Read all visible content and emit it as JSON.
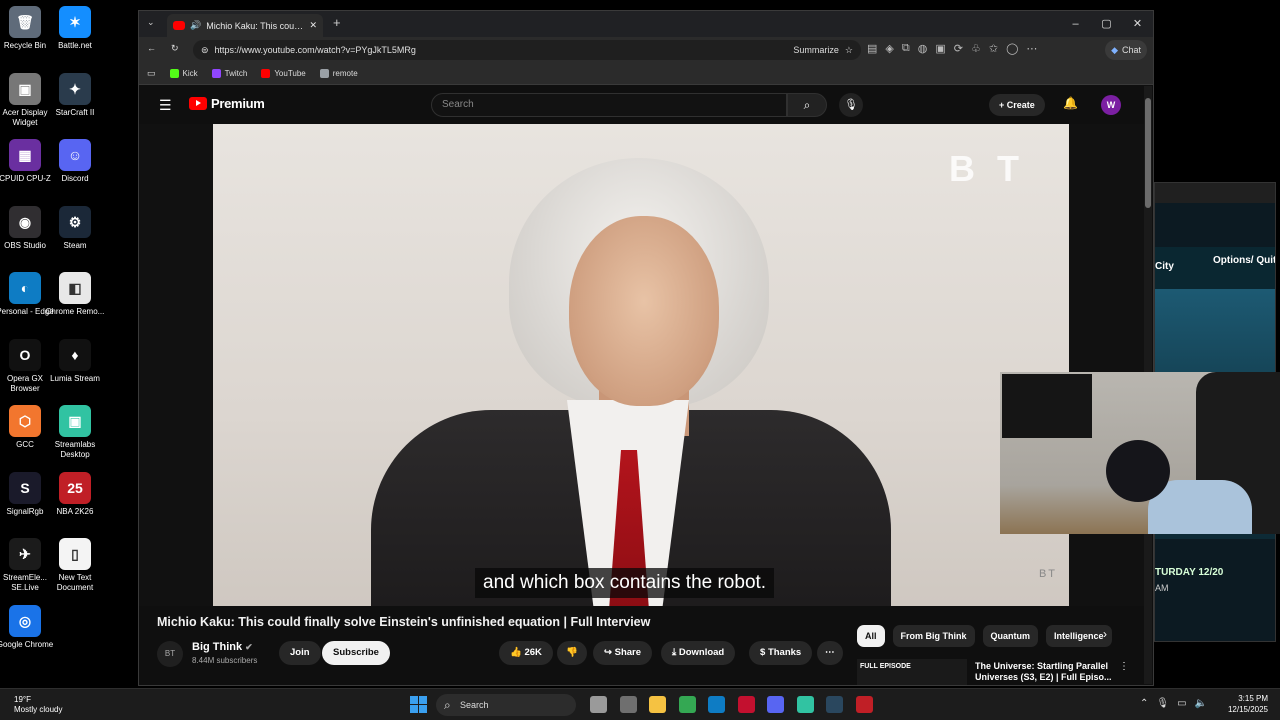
{
  "desktop": {
    "icons": [
      {
        "label": "Recycle Bin",
        "glyph": "🗑",
        "color": "#5f6b7a"
      },
      {
        "label": "Battle.net",
        "glyph": "✶",
        "color": "#148eff"
      },
      {
        "label": "Acer Display Widget",
        "glyph": "▣",
        "color": "#777"
      },
      {
        "label": "StarCraft II",
        "glyph": "✦",
        "color": "#2a3b4c"
      },
      {
        "label": "CPUID CPU-Z",
        "glyph": "▦",
        "color": "#6a2fa0"
      },
      {
        "label": "Discord",
        "glyph": "☺",
        "color": "#5865f2"
      },
      {
        "label": "OBS Studio",
        "glyph": "◉",
        "color": "#302e31"
      },
      {
        "label": "Steam",
        "glyph": "⚙",
        "color": "#1b2838"
      },
      {
        "label": "Personal - Edge",
        "glyph": "◐",
        "color": "#0e7cc4"
      },
      {
        "label": "Chrome Remo...",
        "glyph": "◧",
        "color": "#e8e8e8"
      },
      {
        "label": "Opera GX Browser",
        "glyph": "O",
        "color": "#111"
      },
      {
        "label": "Lumia Stream",
        "glyph": "♦",
        "color": "#111"
      },
      {
        "label": "GCC",
        "glyph": "⬡",
        "color": "#f2762e"
      },
      {
        "label": "Streamlabs Desktop",
        "glyph": "▣",
        "color": "#31c3a2"
      },
      {
        "label": "SignalRgb",
        "glyph": "S",
        "color": "#1a1a2a"
      },
      {
        "label": "NBA 2K26",
        "glyph": "25",
        "color": "#c01f26"
      },
      {
        "label": "StreamEle... SE.Live",
        "glyph": "✈",
        "color": "#1b1b1b"
      },
      {
        "label": "New Text Document",
        "glyph": "▯",
        "color": "#f4f4f4"
      },
      {
        "label": "Google Chrome",
        "glyph": "◎",
        "color": "#1a73e8"
      }
    ]
  },
  "browser": {
    "tab_title": "Michio Kaku: This could finally",
    "url": "https://www.youtube.com/watch?v=PYgJkTL5MRg",
    "summarize_label": "Summarize",
    "chat_label": "Chat",
    "bookmarks": [
      {
        "label": "Kick",
        "color": "#53fc18"
      },
      {
        "label": "Twitch",
        "color": "#9146ff"
      },
      {
        "label": "YouTube",
        "color": "#ff0000"
      },
      {
        "label": "remote",
        "color": "#9aa0a6"
      }
    ]
  },
  "youtube": {
    "logo_text": "Premium",
    "search_placeholder": "Search",
    "create_label": "Create",
    "avatar_letter": "W",
    "caption": "and which box contains the robot.",
    "watermark": "B T",
    "watermark_small": "BT",
    "video_title": "Michio Kaku: This could finally solve Einstein's unfinished equation | Full Interview",
    "channel_name": "Big Think",
    "channel_avatar": "BT",
    "subscribers": "8.44M subscribers",
    "join_label": "Join",
    "subscribe_label": "Subscribe",
    "likes": "26K",
    "share_label": "Share",
    "download_label": "Download",
    "thanks_label": "Thanks",
    "chips": [
      "All",
      "From Big Think",
      "Quantum",
      "Intelligence"
    ],
    "rec_thumb_label": "FULL EPISODE",
    "rec_title": "The Universe: Startling Parallel Universes (S3, E2) | Full Episo..."
  },
  "side_window": {
    "city": "City",
    "options": "Options/ Quit",
    "date": "TURDAY 12/20",
    "am": "AM"
  },
  "taskbar": {
    "temp": "19°F",
    "weather": "Mostly cloudy",
    "search_label": "Search",
    "time": "3:15 PM",
    "date": "12/15/2025",
    "apps": [
      {
        "name": "task-view",
        "color": "#9a9a9a"
      },
      {
        "name": "widgets",
        "color": "#6f6f6f"
      },
      {
        "name": "file-explorer",
        "color": "#f5c242"
      },
      {
        "name": "chrome",
        "color": "#34a853"
      },
      {
        "name": "edge",
        "color": "#0e7cc4"
      },
      {
        "name": "opera-gx",
        "color": "#c3102f"
      },
      {
        "name": "discord",
        "color": "#5865f2"
      },
      {
        "name": "streamlabs",
        "color": "#31c3a2"
      },
      {
        "name": "steam",
        "color": "#2a475e"
      },
      {
        "name": "nba2k",
        "color": "#c01f26"
      }
    ]
  }
}
